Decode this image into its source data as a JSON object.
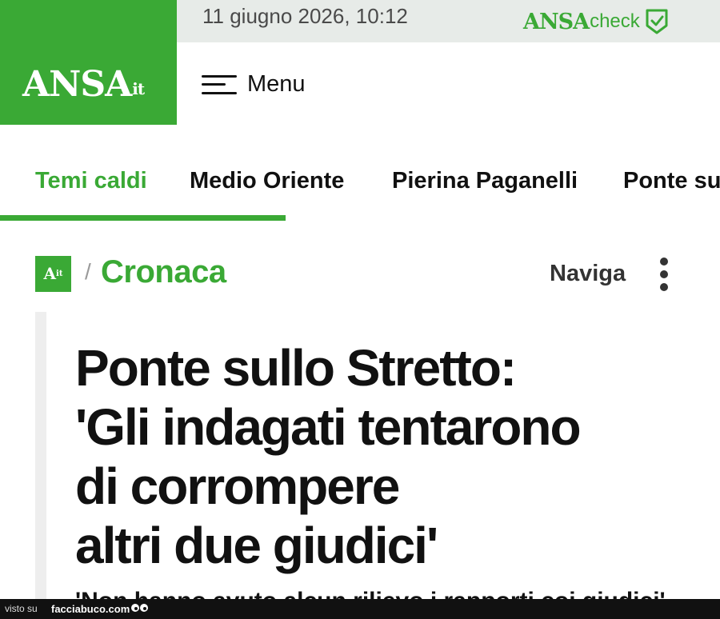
{
  "header": {
    "logo": "ANSA",
    "logo_suffix": "it",
    "datetime": "11 giugno 2026, 10:12",
    "check_brand": "ANSA",
    "check_word": "check",
    "menu_label": "Menu"
  },
  "tabs": [
    {
      "label": "Temi caldi",
      "active": true
    },
    {
      "label": "Medio Oriente"
    },
    {
      "label": "Pierina Paganelli"
    },
    {
      "label": "Ponte sullo Stretto"
    }
  ],
  "breadcrumb": {
    "logo": "A",
    "logo_suffix": "it",
    "separator": "/",
    "section": "Cronaca",
    "naviga_label": "Naviga"
  },
  "article": {
    "headline_lines": [
      "Ponte sullo Stretto:",
      "'Gli indagati tentarono",
      "di corrompere",
      "altri due giudici'"
    ],
    "subheadline": "'Non hanno avuto alcun rilievo i rapporti coi giudici'"
  },
  "watermark": {
    "prefix": "visto su",
    "brand": "facciabuco.com"
  },
  "colors": {
    "brand_green": "#3aa935",
    "date_strip": "#e7ebe8",
    "text": "#111111"
  }
}
